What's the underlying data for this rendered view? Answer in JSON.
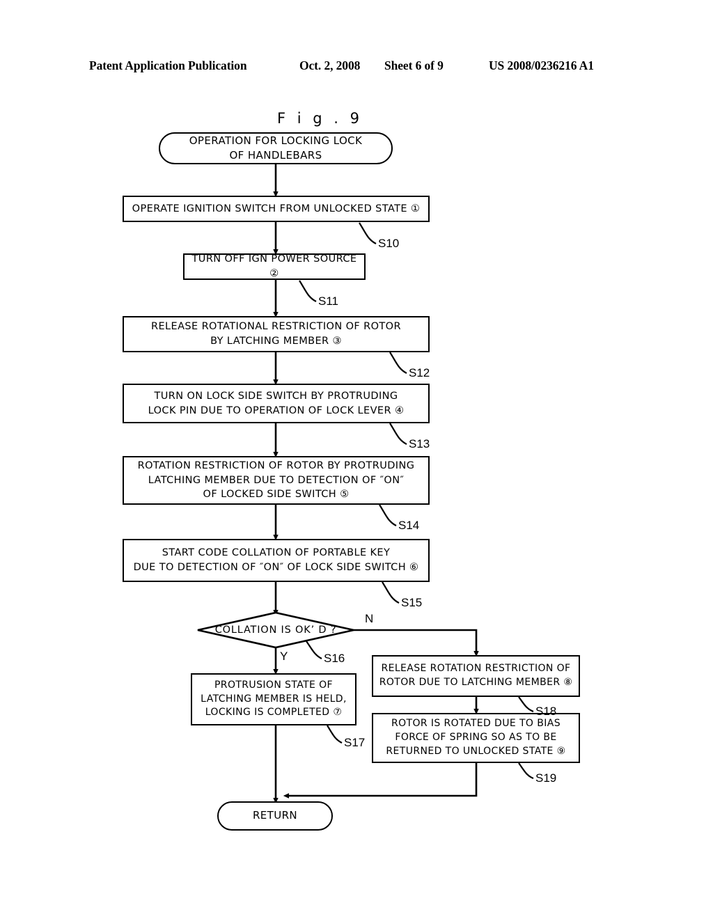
{
  "header": {
    "publication": "Patent Application Publication",
    "date": "Oct. 2, 2008",
    "sheet": "Sheet 6 of 9",
    "patent_number": "US 2008/0236216 A1"
  },
  "figure": {
    "title": "F i g .  9"
  },
  "chart_data": {
    "type": "diagram",
    "diagram_kind": "flowchart",
    "title": "OPERATION FOR LOCKING LOCK OF HANDLEBARS",
    "nodes": [
      {
        "id": "start",
        "shape": "terminator",
        "text": "OPERATION FOR LOCKING LOCK\nOF HANDLEBARS",
        "step": ""
      },
      {
        "id": "s10",
        "shape": "process",
        "text": "OPERATE IGNITION SWITCH FROM UNLOCKED STATE ①",
        "step": "S10"
      },
      {
        "id": "s11",
        "shape": "process",
        "text": "TURN OFF IGN POWER SOURCE ②",
        "step": "S11"
      },
      {
        "id": "s12",
        "shape": "process",
        "text": "RELEASE ROTATIONAL RESTRICTION OF ROTOR\nBY LATCHING MEMBER ③",
        "step": "S12"
      },
      {
        "id": "s13",
        "shape": "process",
        "text": "TURN ON LOCK SIDE SWITCH BY PROTRUDING\nLOCK PIN DUE TO OPERATION OF LOCK LEVER ④",
        "step": "S13"
      },
      {
        "id": "s14",
        "shape": "process",
        "text": "ROTATION RESTRICTION OF ROTOR BY PROTRUDING\nLATCHING MEMBER DUE TO DETECTION OF ″ON″\nOF LOCKED SIDE SWITCH ⑤",
        "step": "S14"
      },
      {
        "id": "s15",
        "shape": "process",
        "text": "START CODE COLLATION OF PORTABLE KEY\nDUE TO DETECTION OF ″ON″ OF LOCK SIDE SWITCH ⑥",
        "step": "S15"
      },
      {
        "id": "s16",
        "shape": "decision",
        "text": "COLLATION IS OK’ D ?",
        "step": "S16"
      },
      {
        "id": "s17",
        "shape": "process",
        "text": "PROTRUSION STATE OF\nLATCHING  MEMBER IS HELD,\nLOCKING IS COMPLETED ⑦",
        "step": "S17"
      },
      {
        "id": "s18",
        "shape": "process",
        "text": "RELEASE ROTATION RESTRICTION OF\nROTOR DUE TO LATCHING MEMBER ⑧",
        "step": "S18"
      },
      {
        "id": "s19",
        "shape": "process",
        "text": "ROTOR IS ROTATED DUE TO BIAS\nFORCE OF SPRING SO AS TO BE\nRETURNED TO UNLOCKED STATE ⑨",
        "step": "S19"
      },
      {
        "id": "return",
        "shape": "terminator",
        "text": "RETURN",
        "step": ""
      }
    ],
    "branch_labels": {
      "yes": "Y",
      "no": "N"
    },
    "edges": [
      {
        "from": "start",
        "to": "s10",
        "label": ""
      },
      {
        "from": "s10",
        "to": "s11",
        "label": ""
      },
      {
        "from": "s11",
        "to": "s12",
        "label": ""
      },
      {
        "from": "s12",
        "to": "s13",
        "label": ""
      },
      {
        "from": "s13",
        "to": "s14",
        "label": ""
      },
      {
        "from": "s14",
        "to": "s15",
        "label": ""
      },
      {
        "from": "s15",
        "to": "s16",
        "label": ""
      },
      {
        "from": "s16",
        "to": "s17",
        "label": "Y"
      },
      {
        "from": "s16",
        "to": "s18",
        "label": "N"
      },
      {
        "from": "s18",
        "to": "s19",
        "label": ""
      },
      {
        "from": "s17",
        "to": "return",
        "label": ""
      },
      {
        "from": "s19",
        "to": "return",
        "label": ""
      }
    ]
  }
}
